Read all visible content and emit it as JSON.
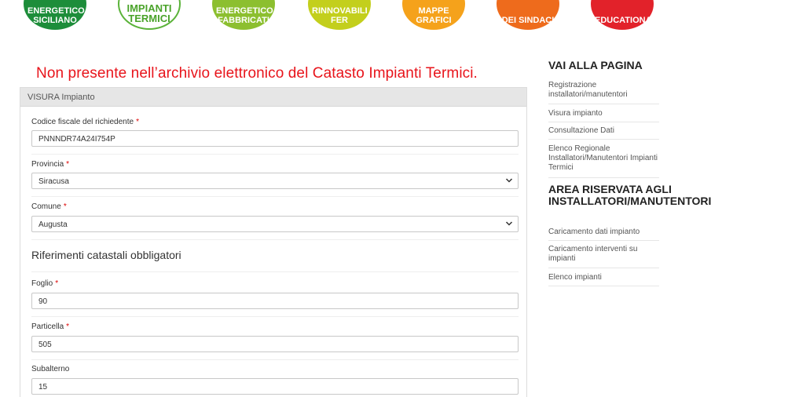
{
  "top_nav": {
    "items": [
      {
        "label": "Energetico Siciliano"
      },
      {
        "label": "Impianti Termici"
      },
      {
        "label": "Energetico Fabbricati"
      },
      {
        "label": "Rinnovabili FER"
      },
      {
        "label": "Mappe Grafici"
      },
      {
        "label": "dei Sindaci"
      },
      {
        "label": "Educational"
      }
    ]
  },
  "notice": "Non presente nell’archivio elettronico del Catasto Impianti Termici.",
  "form": {
    "panel_title": "VISURA Impianto",
    "codice_fiscale": {
      "label": "Codice fiscale del richiedente",
      "value": "PNNNDR74A24I754P"
    },
    "provincia": {
      "label": "Provincia",
      "value": "Siracusa"
    },
    "comune": {
      "label": "Comune",
      "value": "Augusta"
    },
    "section_title": "Riferimenti catastali obbligatori",
    "foglio": {
      "label": "Foglio",
      "value": "90"
    },
    "particella": {
      "label": "Particella",
      "value": "505"
    },
    "subalterno": {
      "label": "Subalterno",
      "value": "15"
    },
    "required_marker": "*"
  },
  "sidebar": {
    "nav_title": "VAI ALLA PAGINA",
    "nav_links": [
      "Registrazione installatori/manutentori",
      "Visura impianto",
      "Consultazione Dati",
      "Elenco Regionale Installatori/Manutentori Impianti Termici"
    ],
    "reserved_title": "AREA RISERVATA AGLI INSTALLATORI/MANUTENTORI",
    "reserved_links": [
      "Caricamento dati impianto",
      "Caricamento interventi su impianti",
      "Elenco impianti"
    ]
  },
  "colors": {
    "notice_red": "#e8141b",
    "required_red": "#dd0000"
  }
}
